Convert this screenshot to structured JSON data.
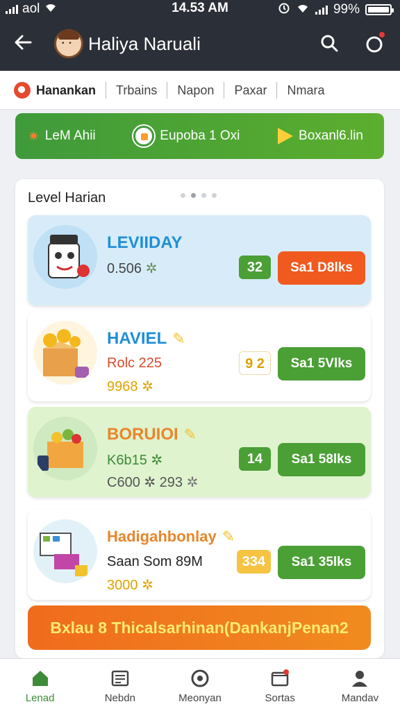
{
  "status_bar": {
    "carrier": "aol",
    "time": "14.53 AM",
    "battery": "99%"
  },
  "header": {
    "title": "Haliya Naruali"
  },
  "tabs": [
    {
      "label": "Hanankan"
    },
    {
      "label": "Trbains"
    },
    {
      "label": "Napon"
    },
    {
      "label": "Paxar"
    },
    {
      "label": "Nmara"
    }
  ],
  "promo": {
    "item1": "LeM Ahii",
    "item2": "Eupoba 1 Oxi",
    "item3": "Boxanl6.lin"
  },
  "panel": {
    "title": "Level Harian"
  },
  "cards": [
    {
      "name": "LEVIIDAY",
      "line1": "0.506",
      "line2": "",
      "badge": "32",
      "action": "Sa1 D8lks"
    },
    {
      "name": "HAVIEL",
      "line1": "Rolc 225",
      "line2": "9968",
      "badge": "9 2",
      "action": "Sa1 5Vlks"
    },
    {
      "name": "BORUIOI",
      "line1": "K6b15",
      "line2": "C600 ✲ 293",
      "badge": "14",
      "action": "Sa1 58lks"
    },
    {
      "name": "Hadigahbonlay",
      "line1": "Saan Som 89M",
      "line2": "3000",
      "badge": "334",
      "action": "Sa1 35lks"
    }
  ],
  "cta": {
    "label": "Bxlau 8 Thicalsarhinan(DankanjPenan2"
  },
  "bottom_nav": [
    {
      "label": "Lenad"
    },
    {
      "label": "Nebdn"
    },
    {
      "label": "Meonyan"
    },
    {
      "label": "Sortas"
    },
    {
      "label": "Mandav"
    }
  ],
  "colors": {
    "header_bg": "#2b2f37",
    "green": "#4a9f35",
    "orange": "#f06b1d",
    "card1_bg": "#d7ecf8",
    "card3_bg": "#dff3cf"
  }
}
